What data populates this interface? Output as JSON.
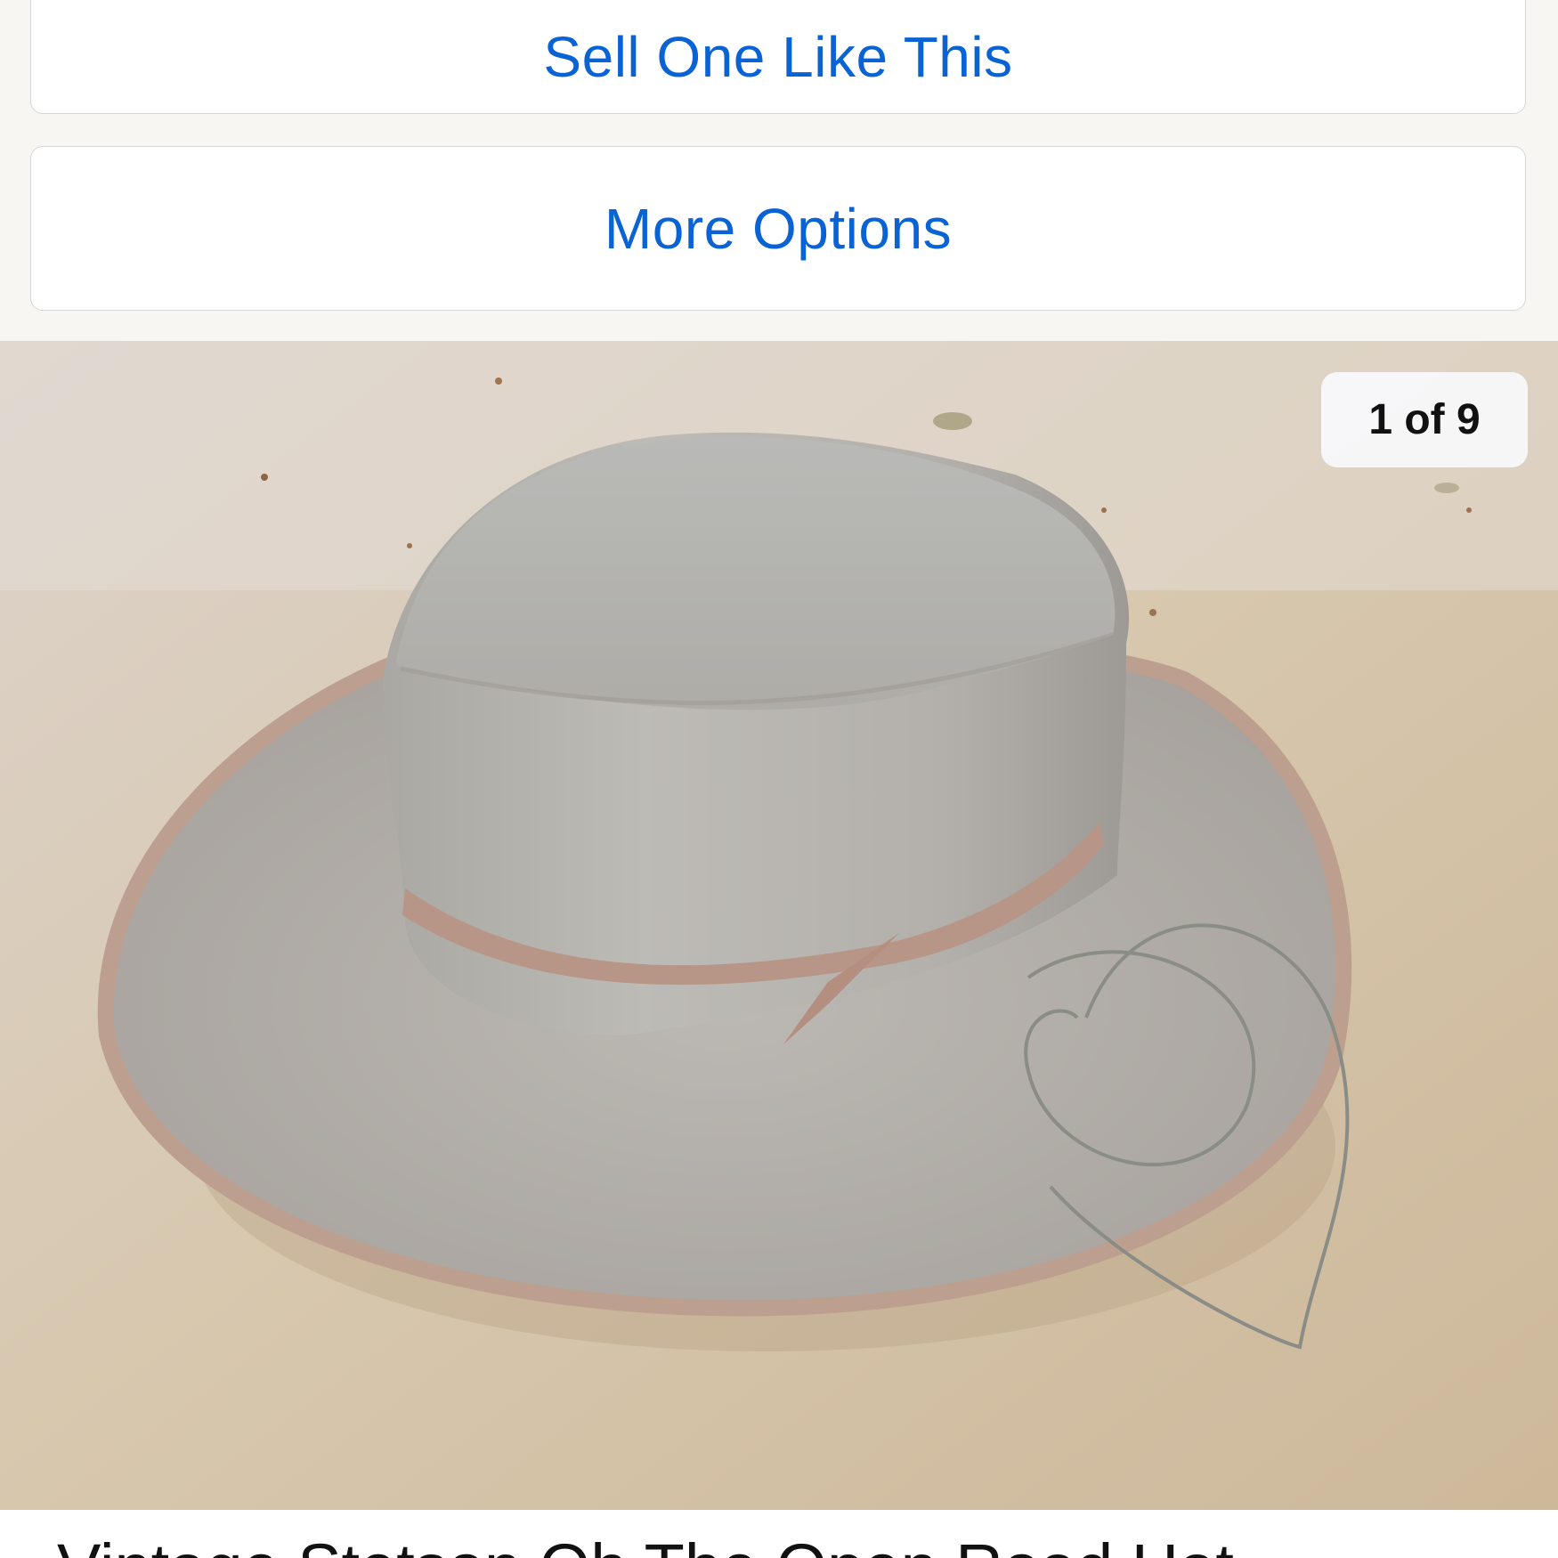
{
  "actions": {
    "sell_label": "Sell One Like This",
    "more_label": "More Options"
  },
  "gallery": {
    "counter": "1 of 9",
    "current_image": 1,
    "total_images": 9
  },
  "listing": {
    "title_partial": "Vintage Stetson Oh The Open Road Hat"
  },
  "colors": {
    "link_blue": "#0a63d4",
    "page_bg": "#f7f6f2"
  }
}
